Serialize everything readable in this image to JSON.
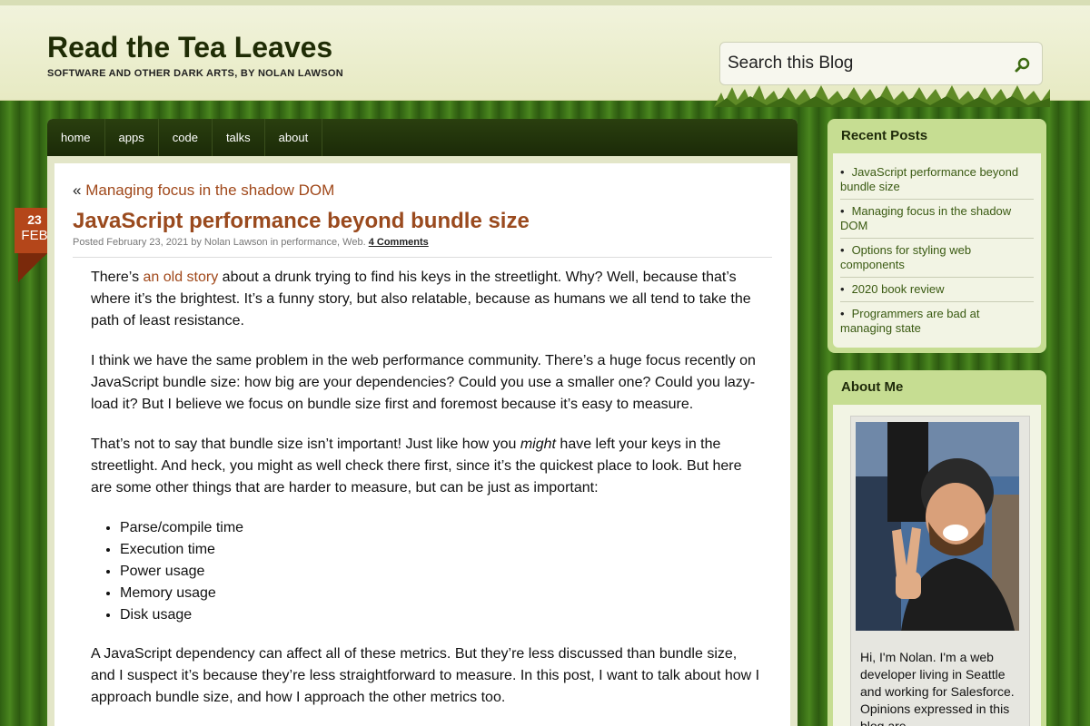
{
  "site": {
    "title": "Read the Tea Leaves",
    "tagline": "SOFTWARE AND OTHER DARK ARTS, BY NOLAN LAWSON"
  },
  "search": {
    "placeholder": "Search this Blog"
  },
  "nav": {
    "items": [
      "home",
      "apps",
      "code",
      "talks",
      "about"
    ]
  },
  "date_badge": {
    "day": "23",
    "month": "FEB"
  },
  "post": {
    "prev_prefix": "«",
    "prev_title": "Managing focus in the shadow DOM",
    "title": "JavaScript performance beyond bundle size",
    "meta": {
      "posted": "Posted February 23, 2021 by Nolan Lawson in performance, Web.",
      "comments": "4 Comments"
    },
    "p1_before": "There’s ",
    "p1_link": "an old story",
    "p1_after": " about a drunk trying to find his keys in the streetlight. Why? Well, because that’s where it’s the brightest. It’s a funny story, but also relatable, because as humans we all tend to take the path of least resistance.",
    "p2": "I think we have the same problem in the web performance community. There’s a huge focus recently on JavaScript bundle size: how big are your dependencies? Could you use a smaller one? Could you lazy-load it? But I believe we focus on bundle size first and foremost because it’s easy to measure.",
    "p3_before": "That’s not to say that bundle size isn’t important! Just like how you ",
    "p3_em": "might",
    "p3_after": " have left your keys in the streetlight. And heck, you might as well check there first, since it’s the quickest place to look. But here are some other things that are harder to measure, but can be just as important:",
    "list": [
      "Parse/compile time",
      "Execution time",
      "Power usage",
      "Memory usage",
      "Disk usage"
    ],
    "p4": "A JavaScript dependency can affect all of these metrics. But they’re less discussed than bundle size, and I suspect it’s because they’re less straightforward to measure. In this post, I want to talk about how I approach bundle size, and how I approach the other metrics too."
  },
  "sidebar": {
    "recent_title": "Recent Posts",
    "recent_posts": [
      "JavaScript performance beyond bundle size",
      "Managing focus in the shadow DOM",
      "Options for styling web components",
      "2020 book review",
      "Programmers are bad at managing state"
    ],
    "about_title": "About Me",
    "about_text": "Hi, I'm Nolan. I'm a web developer living in Seattle and working for Salesforce. Opinions expressed in this blog are"
  },
  "colors": {
    "accent": "#9a4a1e",
    "link": "#a0481a",
    "nav_bg": "#1b2a08",
    "widget_bg": "#c6dd92",
    "badge": "#b4461a"
  }
}
